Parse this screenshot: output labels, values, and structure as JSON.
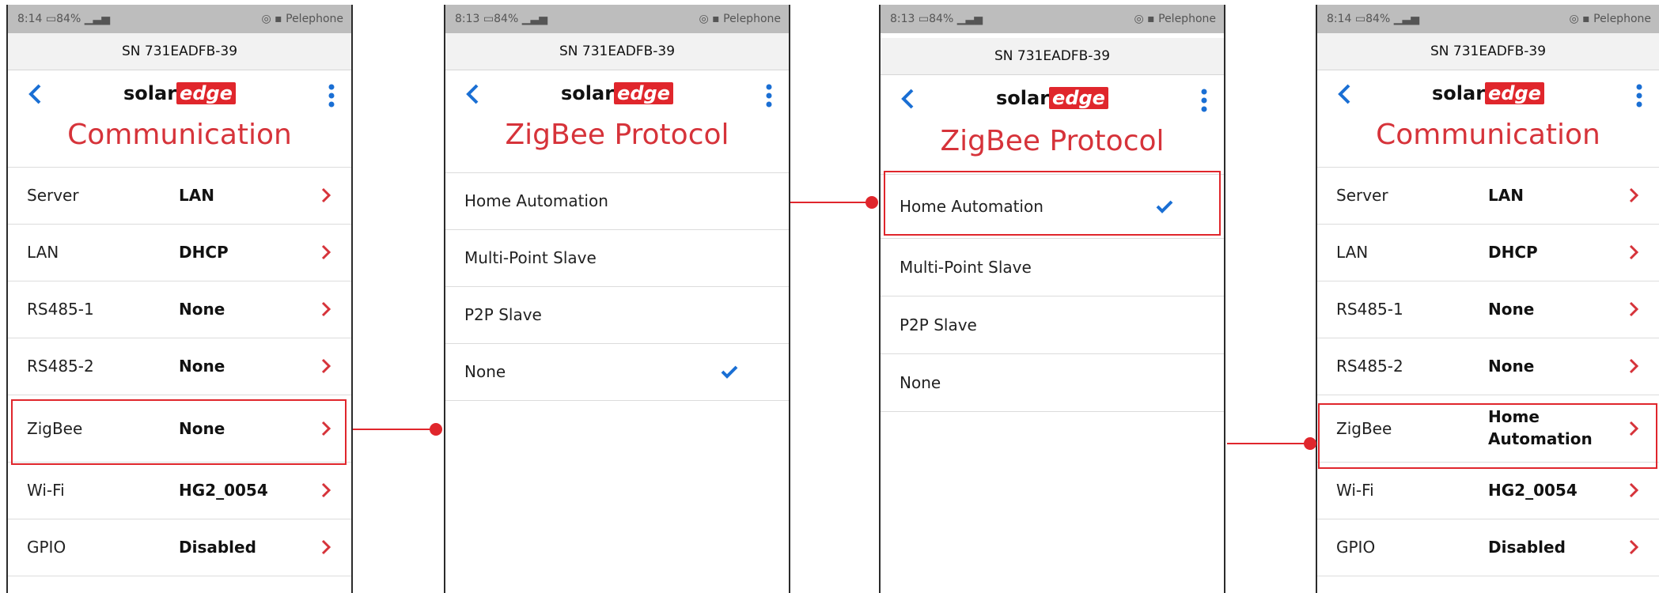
{
  "carrier": "Pelephone",
  "serial": "SN 731EADFB-39",
  "brand": {
    "solar": "solar",
    "edge": "edge"
  },
  "colors": {
    "accent": "#d6333a",
    "link": "#1a6fd4",
    "highlight": "#e0262c"
  },
  "screens": [
    {
      "time": "8:14",
      "battery": "84%",
      "title": "Communication",
      "rows": [
        {
          "label": "Server",
          "value": "LAN"
        },
        {
          "label": "LAN",
          "value": "DHCP"
        },
        {
          "label": "RS485-1",
          "value": "None"
        },
        {
          "label": "RS485-2",
          "value": "None"
        },
        {
          "label": "ZigBee",
          "value": "None"
        },
        {
          "label": "Wi-Fi",
          "value": "HG2_0054"
        },
        {
          "label": "GPIO",
          "value": "Disabled"
        }
      ]
    },
    {
      "time": "8:13",
      "battery": "84%",
      "title": "ZigBee Protocol",
      "rows": [
        {
          "label": "Home Automation"
        },
        {
          "label": "Multi-Point Slave"
        },
        {
          "label": "P2P Slave"
        },
        {
          "label": "None",
          "selected": true
        }
      ]
    },
    {
      "time": "8:13",
      "battery": "84%",
      "title": "ZigBee Protocol",
      "rows": [
        {
          "label": "Home Automation",
          "selected": true
        },
        {
          "label": "Multi-Point Slave"
        },
        {
          "label": "P2P Slave"
        },
        {
          "label": "None"
        }
      ]
    },
    {
      "time": "8:14",
      "battery": "84%",
      "title": "Communication",
      "rows": [
        {
          "label": "Server",
          "value": "LAN"
        },
        {
          "label": "LAN",
          "value": "DHCP"
        },
        {
          "label": "RS485-1",
          "value": "None"
        },
        {
          "label": "RS485-2",
          "value": "None"
        },
        {
          "label": "ZigBee",
          "value_line1": "Home",
          "value_line2": "Automation"
        },
        {
          "label": "Wi-Fi",
          "value": "HG2_0054"
        },
        {
          "label": "GPIO",
          "value": "Disabled"
        }
      ]
    }
  ]
}
